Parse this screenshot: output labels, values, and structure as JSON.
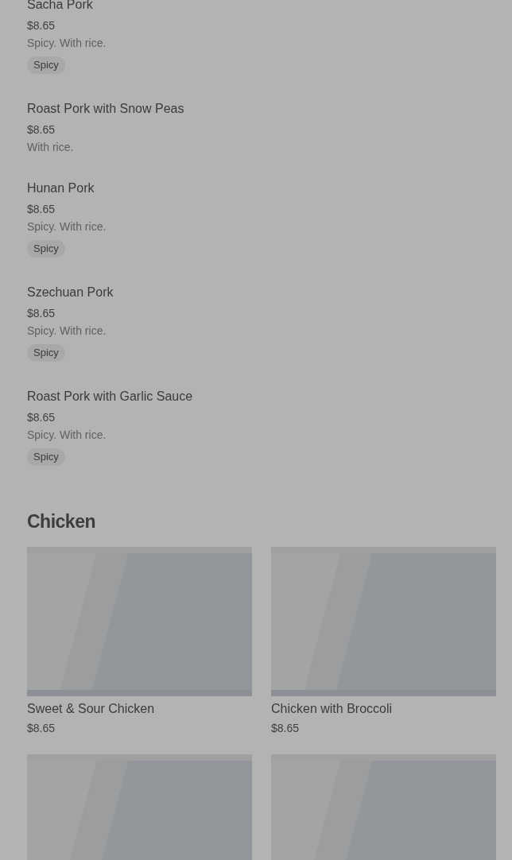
{
  "items": [
    {
      "name": "Sacha Pork",
      "price": "$8.65",
      "description": "Spicy. With rice.",
      "tags": [
        "Spicy"
      ]
    },
    {
      "name": "Roast Pork with Snow Peas",
      "price": "$8.65",
      "description": "With rice."
    },
    {
      "name": "Hunan Pork",
      "price": "$8.65",
      "description": "Spicy. With rice.",
      "tags": [
        "Spicy"
      ]
    },
    {
      "name": "Szechuan Pork",
      "price": "$8.65",
      "description": "Spicy. With rice.",
      "tags": [
        "Spicy"
      ]
    },
    {
      "name": "Roast Pork with Garlic Sauce",
      "price": "$8.65",
      "description": "Spicy. With rice.",
      "tags": [
        "Spicy"
      ]
    }
  ],
  "section": {
    "title": "Chicken",
    "cards": [
      {
        "kind": "picture",
        "name": "Sweet & Sour Chicken",
        "price": "$8.65"
      },
      {
        "kind": "picture",
        "name": "Chicken with Broccoli",
        "price": "$8.65"
      },
      {
        "kind": "picture"
      },
      {
        "kind": "picture"
      }
    ]
  }
}
